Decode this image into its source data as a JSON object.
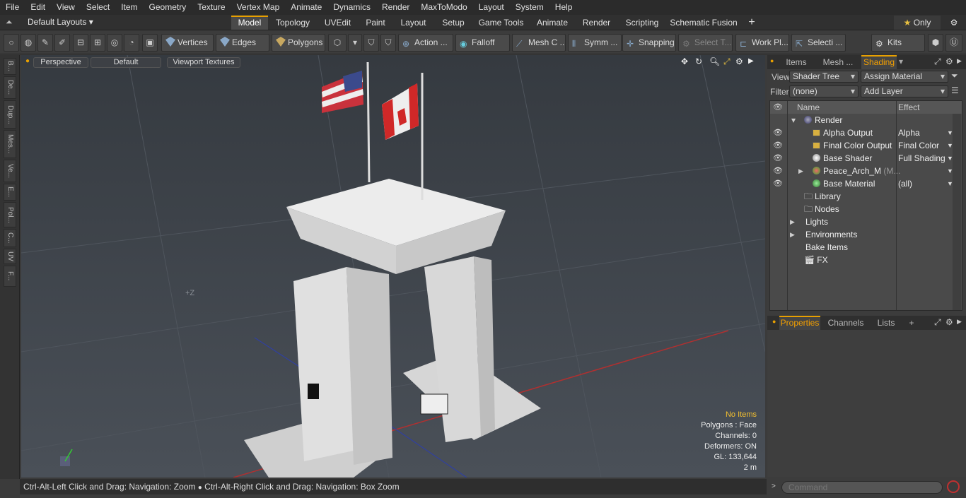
{
  "menu": [
    "File",
    "Edit",
    "View",
    "Select",
    "Item",
    "Geometry",
    "Texture",
    "Vertex Map",
    "Animate",
    "Dynamics",
    "Render",
    "MaxToModo",
    "Layout",
    "System",
    "Help"
  ],
  "layoutbar": {
    "layouts_label": "Default Layouts",
    "tabs": [
      "Model",
      "Topology",
      "UVEdit",
      "Paint",
      "Layout",
      "Setup",
      "Game Tools",
      "Animate",
      "Render",
      "Scripting",
      "Schematic Fusion"
    ],
    "active_tab": "Model",
    "only_label": "Only"
  },
  "toolbar": {
    "vertices": "Vertices",
    "edges": "Edges",
    "polygons": "Polygons",
    "action": "Action ...",
    "falloff": "Falloff",
    "mesh": "Mesh C ...",
    "symm": "Symm ...",
    "snapping": "Snapping",
    "select": "Select T...",
    "workplane": "Work Pl...",
    "selecti": "Selecti ...",
    "kits": "Kits"
  },
  "lefttabs": [
    "B...",
    "De...",
    "Dup...",
    "Mes...",
    "Ve...",
    "E...",
    "Pol...",
    "C...",
    "UV",
    "F..."
  ],
  "viewport": {
    "view_mode": "Perspective",
    "shading": "Default",
    "textures": "Viewport Textures",
    "axis_label": "+Z",
    "info": {
      "items": "No Items",
      "polygons": "Polygons : Face",
      "channels": "Channels: 0",
      "deformers": "Deformers: ON",
      "gl": "GL: 133,644",
      "scale": "2 m"
    }
  },
  "statusbar": {
    "text1": "Ctrl-Alt-Left Click and Drag: Navigation: Zoom",
    "text2": "Ctrl-Alt-Right Click and Drag: Navigation: Box Zoom"
  },
  "rightpanel": {
    "tabs": [
      "Items",
      "Mesh ...",
      "Shading"
    ],
    "active_tab": "Shading",
    "view_label": "View",
    "view_value": "Shader Tree",
    "assign_material": "Assign Material",
    "filter_label": "Filter",
    "filter_value": "(none)",
    "add_layer": "Add Layer",
    "col_name": "Name",
    "col_effect": "Effect",
    "tree": [
      {
        "name": "Render",
        "effect": "",
        "icon": "render-sphere-icon"
      },
      {
        "name": "Alpha Output",
        "effect": "Alpha",
        "icon": "output-icon"
      },
      {
        "name": "Final Color Output",
        "effect": "Final Color",
        "icon": "output-icon"
      },
      {
        "name": "Base Shader",
        "effect": "Full Shading",
        "icon": "shader-icon"
      },
      {
        "name": "Peace_Arch_M",
        "suffix": "(M...",
        "effect": "",
        "icon": "material-icon"
      },
      {
        "name": "Base Material",
        "effect": "(all)",
        "icon": "base-material-icon"
      },
      {
        "name": "Library",
        "effect": "",
        "icon": "folder-icon"
      },
      {
        "name": "Nodes",
        "effect": "",
        "icon": "folder-icon"
      },
      {
        "name": "Lights",
        "effect": "",
        "icon": ""
      },
      {
        "name": "Environments",
        "effect": "",
        "icon": ""
      },
      {
        "name": "Bake Items",
        "effect": "",
        "icon": ""
      },
      {
        "name": "FX",
        "effect": "",
        "icon": "fx-icon"
      }
    ],
    "bottom_tabs": [
      "Properties",
      "Channels",
      "Lists"
    ],
    "bottom_active": "Properties",
    "command_placeholder": "Command"
  },
  "colors": {
    "accent": "#e8a000",
    "highlight": "#f4c030"
  }
}
